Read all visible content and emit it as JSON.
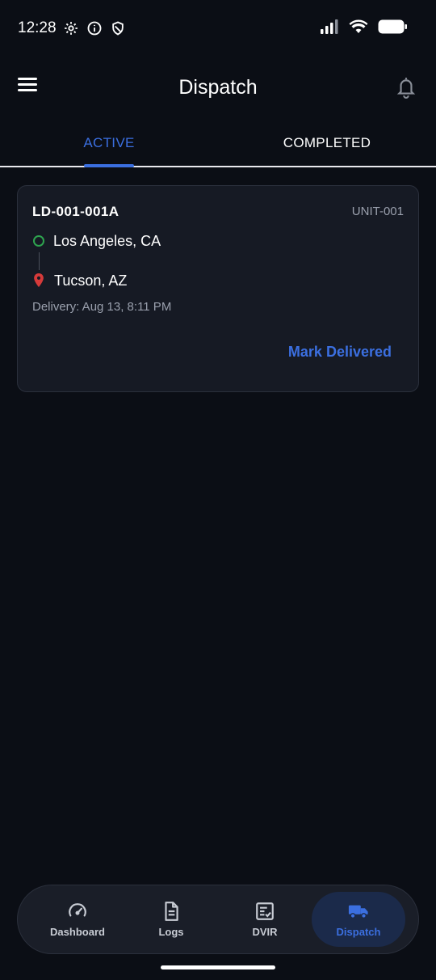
{
  "status_bar": {
    "time": "12:28",
    "left_icons": [
      "gear-icon",
      "info-icon",
      "shield-icon"
    ],
    "right_icons": [
      "signal-icon",
      "wifi-icon",
      "battery-icon"
    ]
  },
  "header": {
    "title": "Dispatch",
    "menu_icon": "hamburger-menu-icon",
    "notification_icon": "bell-icon"
  },
  "tabs": [
    {
      "label": "ACTIVE",
      "active": true
    },
    {
      "label": "COMPLETED",
      "active": false
    }
  ],
  "loads": [
    {
      "load_id": "LD-001-001A",
      "unit": "UNIT-001",
      "origin": "Los Angeles, CA",
      "destination": "Tucson, AZ",
      "delivery": "Delivery: Aug 13, 8:11 PM",
      "action_label": "Mark Delivered"
    }
  ],
  "bottom_nav": [
    {
      "label": "Dashboard",
      "icon": "speedometer-icon",
      "active": false
    },
    {
      "label": "Logs",
      "icon": "document-icon",
      "active": false
    },
    {
      "label": "DVIR",
      "icon": "checklist-icon",
      "active": false
    },
    {
      "label": "Dispatch",
      "icon": "truck-icon",
      "active": true
    }
  ],
  "colors": {
    "background": "#0b0e15",
    "card": "#161a24",
    "accent": "#3b6fe0",
    "origin": "#2ea44f",
    "destination": "#d63a3a",
    "muted_text": "#9aa0ad"
  }
}
